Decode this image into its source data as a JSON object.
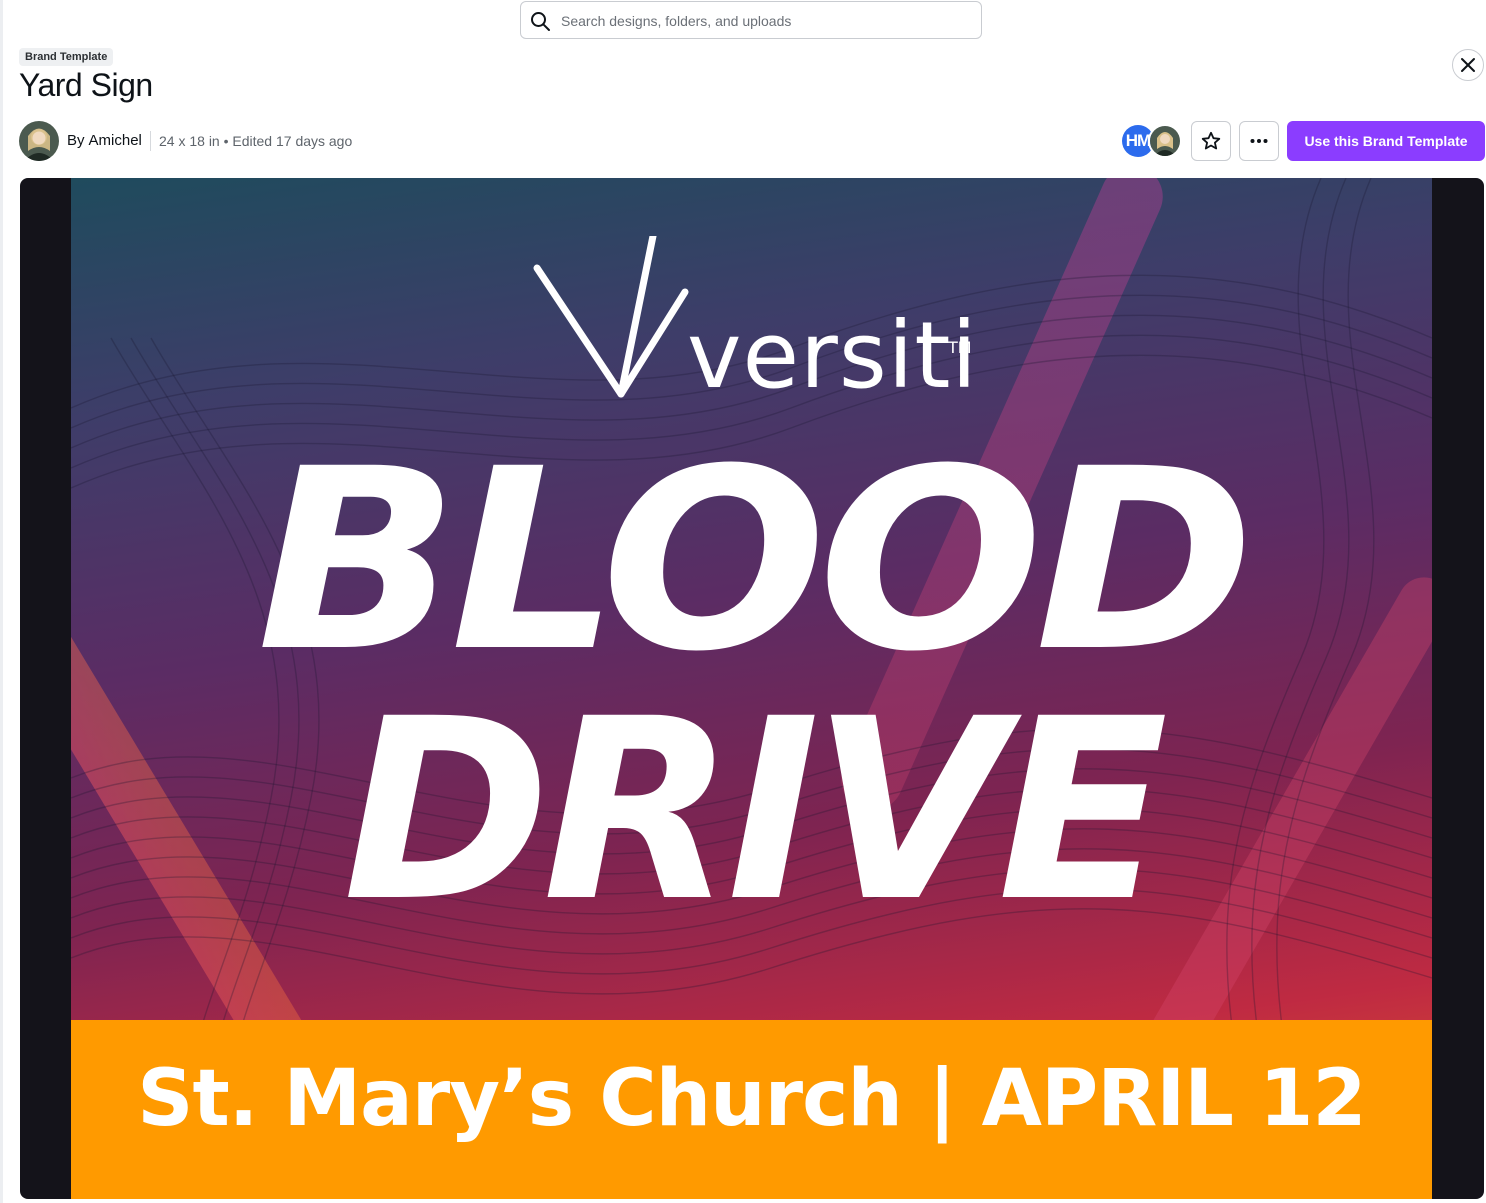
{
  "search": {
    "placeholder": "Search designs, folders, and uploads"
  },
  "header": {
    "badge": "Brand Template",
    "title": "Yard Sign",
    "author_prefix": "By",
    "author_name": "Amichel",
    "meta": "24 x 18 in • Edited 17 days ago"
  },
  "collaborators": {
    "initials": "HM"
  },
  "actions": {
    "use_template_label": "Use this Brand Template"
  },
  "design": {
    "logo_text": "versiti",
    "logo_tm": "TM",
    "headline_line1": "BLOOD",
    "headline_line2": "DRIVE",
    "banner_text": "St. Mary’s Church | APRIL 12"
  },
  "colors": {
    "accent": "#8b3dff",
    "collaborator_badge": "#2c6bed",
    "banner": "#ff9a00",
    "gradient_top": "#1f4b5d",
    "gradient_bottom": "#e35a2b"
  },
  "icons": [
    "search-icon",
    "close-icon",
    "star-icon",
    "more-icon",
    "versiti-logo-mark"
  ]
}
